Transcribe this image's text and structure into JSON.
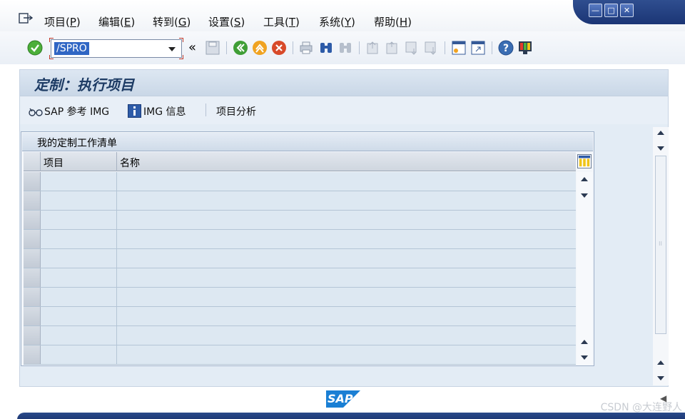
{
  "menu": {
    "items": [
      {
        "label": "项目(",
        "key": "P",
        "close": ")"
      },
      {
        "label": "编辑(",
        "key": "E",
        "close": ")"
      },
      {
        "label": "转到(",
        "key": "G",
        "close": ")"
      },
      {
        "label": "设置(",
        "key": "S",
        "close": ")"
      },
      {
        "label": "工具(",
        "key": "T",
        "close": ")"
      },
      {
        "label": "系统(",
        "key": "Y",
        "close": ")"
      },
      {
        "label": "帮助(",
        "key": "H",
        "close": ")"
      }
    ]
  },
  "toolbar": {
    "command_value": "/SPRO",
    "back_double": "«"
  },
  "page": {
    "title": "定制：执行项目"
  },
  "app_toolbar": {
    "sap_ref_img": "SAP 参考 IMG",
    "img_info": "IMG 信息",
    "project_analysis": "项目分析"
  },
  "worklist": {
    "caption": "我的定制工作清单",
    "columns": [
      "项目",
      "名称"
    ],
    "rows": [
      "",
      "",
      "",
      "",
      "",
      "",
      "",
      "",
      "",
      ""
    ]
  },
  "footer": {
    "logo_text": "SAP",
    "watermark": "CSDN @大连野人"
  },
  "colors": {
    "accent": "#1b3575",
    "frame": "#e3ecf5",
    "title_text": "#1d3b64"
  }
}
